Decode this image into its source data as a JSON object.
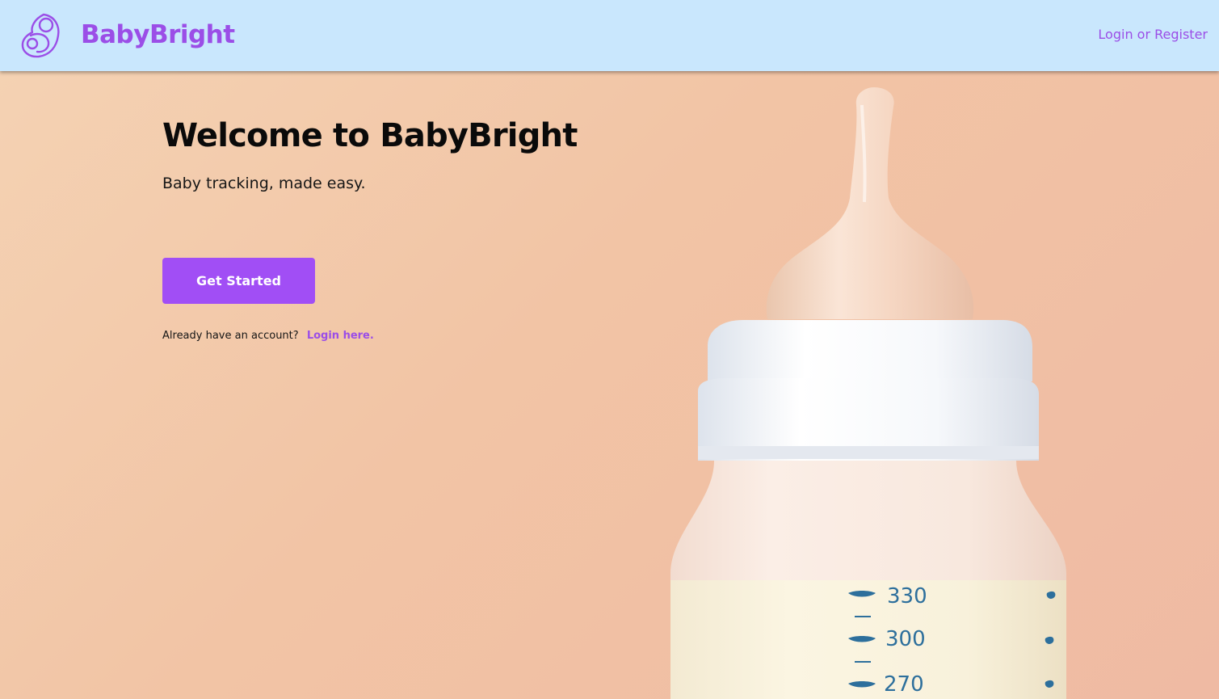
{
  "header": {
    "brand_name": "BabyBright",
    "auth_link_label": "Login or Register",
    "logo_icon": "mother-baby-icon"
  },
  "hero": {
    "title": "Welcome to BabyBright",
    "subtitle": "Baby tracking, made easy.",
    "cta_label": "Get Started",
    "account_prompt": "Already have an account?",
    "login_link_label": "Login here."
  },
  "bottle_image": {
    "markings": [
      "330",
      "300",
      "270"
    ]
  },
  "colors": {
    "brand": "#9b4ee7",
    "button": "#a14ef5",
    "header_bg": "#c9e7fd",
    "hero_bg": "#f2c4a5"
  }
}
